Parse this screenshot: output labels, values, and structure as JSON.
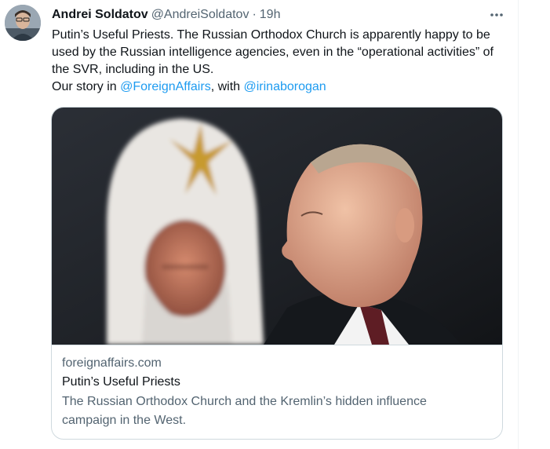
{
  "tweet": {
    "author_name": "Andrei Soldatov",
    "handle": "@AndreiSoldatov",
    "separator": "·",
    "timestamp": "19h",
    "more_icon": "more-horizontal-icon",
    "text_line_1": "Putin’s Useful Priests. The Russian Orthodox Church is apparently happy to be used by the Russian intelligence agencies, even in the “operational activities” of the SVR, including in the US.",
    "text_line_2_prefix": "Our story in ",
    "mention_1": "@ForeignAffairs",
    "text_line_2_middle": ", with ",
    "mention_2": "@irinaborogan",
    "link_color": "#1d9bf0"
  },
  "card": {
    "domain": "foreignaffairs.com",
    "title": "Putin’s Useful Priests",
    "description": "The Russian Orthodox Church and the Kremlin’s hidden influence campaign in the West."
  }
}
